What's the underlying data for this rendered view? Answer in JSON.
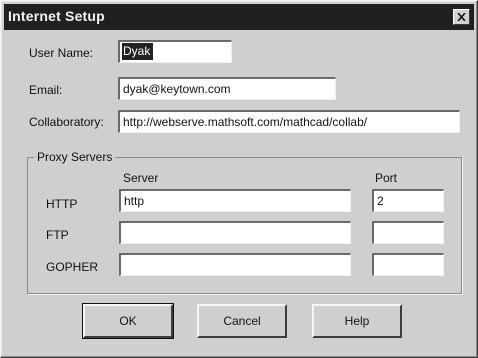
{
  "window": {
    "title": "Internet Setup",
    "close_icon": "close-icon"
  },
  "fields": {
    "user_name": {
      "label": "User Name:",
      "value": "Dyak"
    },
    "email": {
      "label": "Email:",
      "value": "dyak@keytown.com"
    },
    "collaboratory": {
      "label": "Collaboratory:",
      "value": "http://webserve.mathsoft.com/mathcad/collab/"
    }
  },
  "proxy": {
    "group_title": "Proxy Servers",
    "server_header": "Server",
    "port_header": "Port",
    "rows": [
      {
        "label": "HTTP",
        "server": "http",
        "port": "2"
      },
      {
        "label": "FTP",
        "server": "",
        "port": ""
      },
      {
        "label": "GOPHER",
        "server": "",
        "port": ""
      }
    ]
  },
  "buttons": {
    "ok": "OK",
    "cancel": "Cancel",
    "help": "Help"
  }
}
